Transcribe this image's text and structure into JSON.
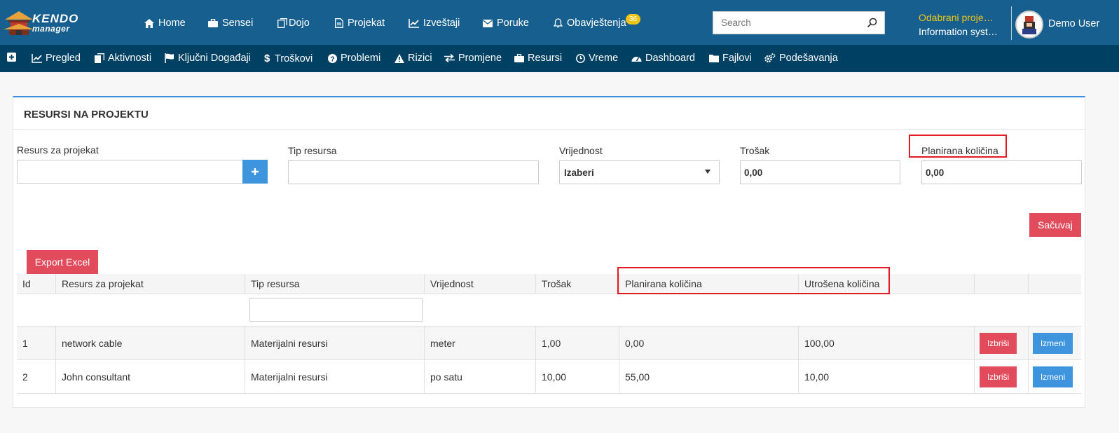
{
  "brand": {
    "logo_line1": "KENDO",
    "logo_line2": "manager"
  },
  "topnav": {
    "items": [
      {
        "label": "Home",
        "icon": "home-icon"
      },
      {
        "label": "Sensei",
        "icon": "briefcase-icon"
      },
      {
        "label": "Dojo",
        "icon": "copy-icon"
      },
      {
        "label": "Projekat",
        "icon": "file-icon"
      },
      {
        "label": "Izveštaji",
        "icon": "line-chart-icon"
      },
      {
        "label": "Poruke",
        "icon": "envelope-icon"
      },
      {
        "label": "Obavještenja",
        "icon": "bell-icon"
      }
    ],
    "notifications_count": "36",
    "search_placeholder": "Search",
    "selected_project_label": "Odabrani proje…",
    "selected_project_value": "Information syst…",
    "user_name": "Demo User"
  },
  "subnav": {
    "items": [
      {
        "label": "Pregled",
        "icon": "line-chart-icon"
      },
      {
        "label": "Aktivnosti",
        "icon": "copy-icon"
      },
      {
        "label": "Ključni Događaji",
        "icon": "flag-icon"
      },
      {
        "label": "Troškovi",
        "icon": "dollar-icon"
      },
      {
        "label": "Problemi",
        "icon": "question-circle-icon"
      },
      {
        "label": "Rizici",
        "icon": "warning-icon"
      },
      {
        "label": "Promjene",
        "icon": "exchange-icon"
      },
      {
        "label": "Resursi",
        "icon": "briefcase-icon"
      },
      {
        "label": "Vreme",
        "icon": "clock-icon"
      },
      {
        "label": "Dashboard",
        "icon": "dashboard-icon"
      },
      {
        "label": "Fajlovi",
        "icon": "folder-icon"
      },
      {
        "label": "Podešavanja",
        "icon": "cogs-icon"
      }
    ]
  },
  "panel": {
    "title": "RESURSI NA PROJEKTU"
  },
  "form": {
    "resource_label": "Resurs za projekat",
    "resource_value": "",
    "type_label": "Tip resursa",
    "type_value": "",
    "value_label": "Vrijednost",
    "value_selected": "Izaberi",
    "cost_label": "Trošak",
    "cost_value": "0,00",
    "planned_label": "Planirana količina",
    "planned_value": "0,00",
    "save_label": "Sačuvaj"
  },
  "grid": {
    "export_label": "Export Excel",
    "columns": [
      "Id",
      "Resurs za projekat",
      "Tip resursa",
      "Vrijednost",
      "Trošak",
      "Planirana količina",
      "Utrošena količina",
      "",
      ""
    ],
    "rows": [
      {
        "id": "1",
        "resource": "network cable",
        "type": "Materijalni resursi",
        "value": "meter",
        "cost": "1,00",
        "planned": "0,00",
        "used": "100,00",
        "delete_label": "Izbriši",
        "edit_label": "Izmeni"
      },
      {
        "id": "2",
        "resource": "John consultant",
        "type": "Materijalni resursi",
        "value": "po satu",
        "cost": "10,00",
        "planned": "55,00",
        "used": "10,00",
        "delete_label": "Izbriši",
        "edit_label": "Izmeni"
      }
    ]
  },
  "colors": {
    "topbar": "#175f8e",
    "subbar": "#004063",
    "accent_blue": "#3e94dd",
    "accent_red": "#e24b5b",
    "highlight": "#e21b23",
    "badge": "#f0c419"
  }
}
